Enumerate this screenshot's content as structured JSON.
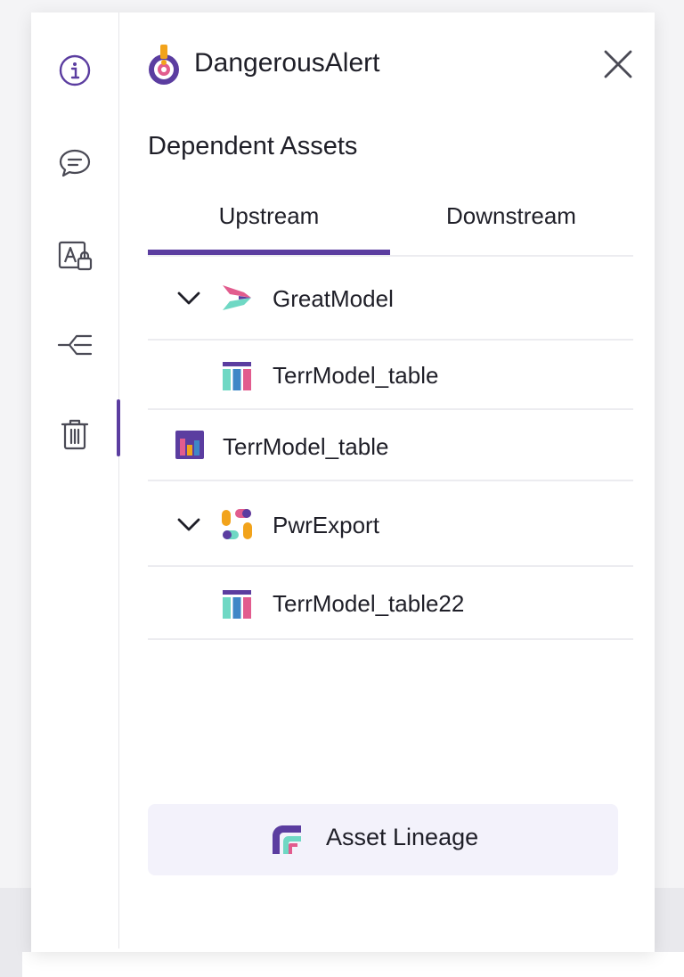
{
  "rail": {
    "items": [
      {
        "icon": "info-icon"
      },
      {
        "icon": "comment-icon"
      },
      {
        "icon": "access-lock-icon"
      },
      {
        "icon": "lineage-icon"
      },
      {
        "icon": "trash-icon",
        "active": true
      }
    ]
  },
  "header": {
    "title": "DangerousAlert",
    "title_icon": "alert-target-icon"
  },
  "section": {
    "title": "Dependent Assets"
  },
  "tabs": [
    {
      "label": "Upstream",
      "active": true
    },
    {
      "label": "Downstream",
      "active": false
    }
  ],
  "tree": [
    {
      "label": "GreatModel",
      "icon": "model-icon",
      "expanded": true,
      "level": 0
    },
    {
      "label": "TerrModel_table",
      "icon": "table-icon",
      "level": 1
    },
    {
      "label": "TerrModel_table",
      "icon": "bar-chart-icon",
      "level": 0
    },
    {
      "label": "PwrExport",
      "icon": "export-icon",
      "expanded": true,
      "level": 0
    },
    {
      "label": "TerrModel_table22",
      "icon": "table-icon",
      "level": 1
    }
  ],
  "footer": {
    "lineage_label": "Asset Lineage",
    "lineage_icon": "asset-lineage-icon"
  },
  "colors": {
    "accent": "#5b3da0",
    "pink": "#e25c8e",
    "teal": "#6fd8c4",
    "orange": "#f2a31b",
    "blue": "#3f87c7",
    "button_bg": "#f3f2fb"
  }
}
